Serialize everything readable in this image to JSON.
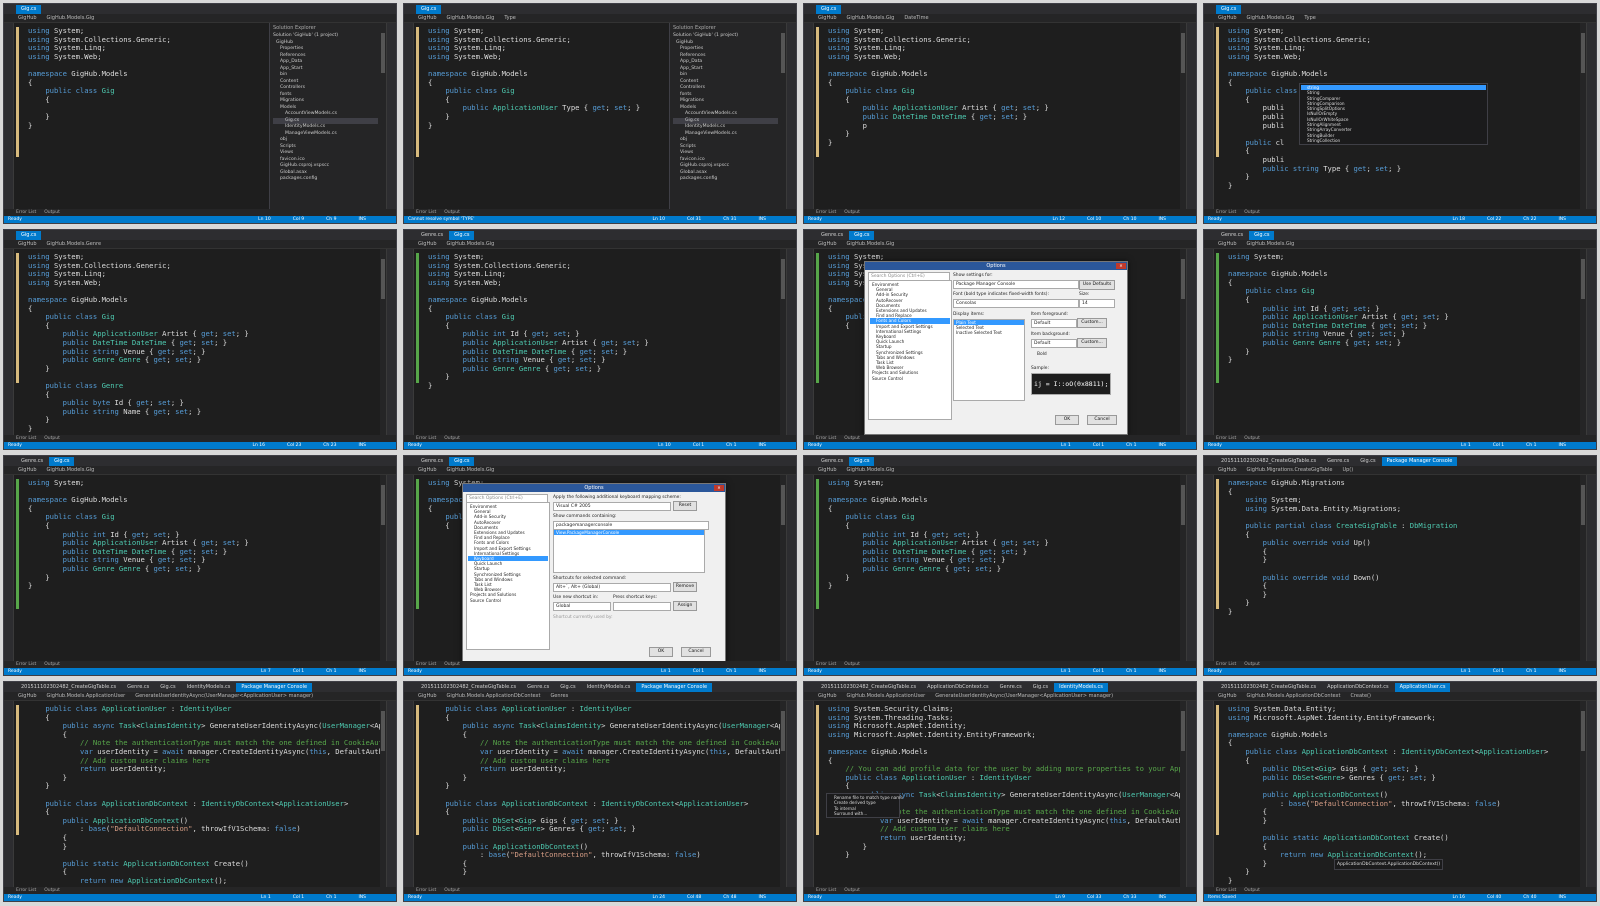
{
  "colors": {
    "accent": "#007acc",
    "editor_bg": "#1e1e1e",
    "keyword": "#569cd6",
    "type": "#4ec9b0",
    "comment": "#57a64a",
    "string": "#d69d85"
  },
  "panels": [
    {
      "tabs": [
        "Gig.cs"
      ],
      "nav": [
        "GigHub",
        "GigHub.Models.Gig"
      ],
      "code": "using System;\nusing System.Collections.Generic;\nusing System.Linq;\nusing System.Web;\n\nnamespace GigHub.Models\n{\n    public class Gig\n    {\n\n    }\n}",
      "status": [
        "Ready",
        "Ln 10",
        "Col 9",
        "Ch 9",
        "INS"
      ],
      "solution_explorer": {
        "title": "Solution Explorer",
        "items": [
          "Solution 'GigHub' (1 project)",
          "GigHub",
          "Properties",
          "References",
          "App_Data",
          "App_Start",
          "bin",
          "Content",
          "Controllers",
          "fonts",
          "Migrations",
          "Models",
          "AccountViewModels.cs",
          "Gig.cs",
          "IdentityModels.cs",
          "ManageViewModels.cs",
          "obj",
          "Scripts",
          "Views",
          "favicon.ico",
          "GigHub.csproj.vspscc",
          "Global.asax",
          "packages.config"
        ]
      }
    },
    {
      "tabs": [
        "Gig.cs"
      ],
      "nav": [
        "GigHub",
        "GigHub.Models.Gig",
        "Type"
      ],
      "code": "using System;\nusing System.Collections.Generic;\nusing System.Linq;\nusing System.Web;\n\nnamespace GigHub.Models\n{\n    public class Gig\n    {\n        public ApplicationUser Type { get; set; }\n    }\n}",
      "status": [
        "Cannot resolve symbol 'TYPE'",
        "Ln 10",
        "Col 31",
        "Ch 31",
        "INS"
      ],
      "solution_explorer": {
        "title": "Solution Explorer",
        "items": [
          "Solution 'GigHub' (1 project)",
          "GigHub",
          "Properties",
          "References",
          "App_Data",
          "App_Start",
          "bin",
          "Content",
          "Controllers",
          "fonts",
          "Migrations",
          "Models",
          "AccountViewModels.cs",
          "Gig.cs",
          "IdentityModels.cs",
          "ManageViewModels.cs",
          "obj",
          "Scripts",
          "Views",
          "favicon.ico",
          "GigHub.csproj.vspscc",
          "Global.asax",
          "packages.config"
        ]
      }
    },
    {
      "tabs": [
        "Gig.cs"
      ],
      "nav": [
        "GigHub",
        "GigHub.Models.Gig",
        "DateTime"
      ],
      "code": "using System;\nusing System.Collections.Generic;\nusing System.Linq;\nusing System.Web;\n\nnamespace GigHub.Models\n{\n    public class Gig\n    {\n        public ApplicationUser Artist { get; set; }\n        public DateTime DateTime { get; set; }\n        p\n    }\n}",
      "status": [
        "Ready",
        "Ln 12",
        "Col 10",
        "Ch 10",
        "INS"
      ]
    },
    {
      "tabs": [
        "Gig.cs"
      ],
      "nav": [
        "GigHub",
        "GigHub.Models.Gig",
        "Type"
      ],
      "code": "using System;\nusing System.Collections.Generic;\nusing System.Linq;\nusing System.Web;\n\nnamespace GigHub.Models\n{\n    public class Gig\n    {\n        publi\n        publi\n        publi\n\n    public cl\n    {\n        publi\n        public string Type { get; set; }\n    }\n}",
      "status": [
        "Ready",
        "Ln 18",
        "Col 22",
        "Ch 22",
        "INS"
      ],
      "completion": [
        "string",
        "String",
        "StringComparer",
        "StringComparison",
        "StringSplitOptions",
        "IsNullOrEmpty",
        "IsNullOrWhiteSpace",
        "StringAlignment",
        "StringArrayConverter",
        "StringBuilder",
        "StringCollection"
      ]
    },
    {
      "tabs": [
        "Gig.cs"
      ],
      "nav": [
        "GigHub",
        "GigHub.Models.Genre"
      ],
      "code": "using System;\nusing System.Collections.Generic;\nusing System.Linq;\nusing System.Web;\n\nnamespace GigHub.Models\n{\n    public class Gig\n    {\n        public ApplicationUser Artist { get; set; }\n        public DateTime DateTime { get; set; }\n        public string Venue { get; set; }\n        public Genre Genre { get; set; }\n    }\n\n    public class Genre\n    {\n        public byte Id { get; set; }\n        public string Name { get; set; }\n    }\n}",
      "status": [
        "Ready",
        "Ln 16",
        "Col 23",
        "Ch 23",
        "INS"
      ]
    },
    {
      "tabs": [
        "Genre.cs",
        "Gig.cs"
      ],
      "nav": [
        "GigHub",
        "GigHub.Models.Gig"
      ],
      "code": "using System;\nusing System.Collections.Generic;\nusing System.Linq;\nusing System.Web;\n\nnamespace GigHub.Models\n{\n    public class Gig\n    {\n        public int Id { get; set; }\n        public ApplicationUser Artist { get; set; }\n        public DateTime DateTime { get; set; }\n        public string Venue { get; set; }\n        public Genre Genre { get; set; }\n    }\n}",
      "status": [
        "Ready",
        "Ln 10",
        "Col 1",
        "Ch 1",
        "INS"
      ]
    },
    {
      "tabs": [
        "Genre.cs",
        "Gig.cs"
      ],
      "nav": [
        "GigHub",
        "GigHub.Models.Gig"
      ],
      "code": "using System;\nusing System.Collections.Generic;\nusing System.Linq;\nusing System.Web;\n\nnamespace GigHub.Models\n{\n    public class Gig\n    {",
      "status": [
        "Ready",
        "Ln 1",
        "Col 1",
        "Ch 1",
        "INS"
      ],
      "options": {
        "title": "Options",
        "search": "Search Options (Ctrl+E)",
        "show_settings": "Show settings for:",
        "show_settings_value": "Package Manager Console",
        "use_defaults": "Use Defaults",
        "font_label": "Font (bold type indicates fixed-width fonts):",
        "font_value": "Consolas",
        "size_label": "Size:",
        "size_value": "14",
        "display_items": "Display items:",
        "display_list": [
          "Plain Text",
          "Selected Text",
          "Inactive Selected Text"
        ],
        "fg_label": "Item foreground:",
        "fg_value": "Default",
        "bg_label": "Item background:",
        "bg_value": "Default",
        "custom": "Custom...",
        "bold": "Bold",
        "sample_label": "Sample:",
        "sample": "ij = I::oO(0x8811);",
        "ok": "OK",
        "cancel": "Cancel",
        "tree": [
          "Environment",
          "General",
          "Add-in Security",
          "AutoRecover",
          "Documents",
          "Extensions and Updates",
          "Find and Replace",
          "Fonts and Colors",
          "Import and Export Settings",
          "International Settings",
          "Keyboard",
          "Quick Launch",
          "Startup",
          "Synchronized Settings",
          "Tabs and Windows",
          "Task List",
          "Web Browser",
          "Projects and Solutions",
          "Source Control"
        ]
      }
    },
    {
      "tabs": [
        "Genre.cs",
        "Gig.cs"
      ],
      "nav": [
        "GigHub",
        "GigHub.Models.Gig"
      ],
      "code": "using System;\n\nnamespace GigHub.Models\n{\n    public class Gig\n    {\n        public int Id { get; set; }\n        public ApplicationUser Artist { get; set; }\n        public DateTime DateTime { get; set; }\n        public string Venue { get; set; }\n        public Genre Genre { get; set; }\n    }\n}",
      "status": [
        "Ready",
        "Ln 1",
        "Col 1",
        "Ch 1",
        "INS"
      ]
    },
    {
      "tabs": [
        "Genre.cs",
        "Gig.cs"
      ],
      "nav": [
        "GigHub",
        "GigHub.Models.Gig"
      ],
      "code": "using System;\n\nnamespace GigHub.Models\n{\n    public class Gig\n    {\n        public int Id { get; set; }\n        public ApplicationUser Artist { get; set; }\n        public DateTime DateTime { get; set; }\n        public string Venue { get; set; }\n        public Genre Genre { get; set; }\n    }\n}",
      "status": [
        "Ready",
        "Ln 7",
        "Col 1",
        "Ch 1",
        "INS"
      ]
    },
    {
      "tabs": [
        "Genre.cs",
        "Gig.cs"
      ],
      "nav": [
        "GigHub",
        "GigHub.Models.Gig"
      ],
      "code": "using System;\n\nnamespace GigHub.Models\n{\n    public class Gig\n    {",
      "status": [
        "Ready",
        "Ln 1",
        "Col 1",
        "Ch 1",
        "INS"
      ],
      "options": {
        "title": "Options",
        "search": "Search Options (Ctrl+E)",
        "mapping_label": "Apply the following additional keyboard mapping scheme:",
        "mapping_value": "Visual C# 2005",
        "reset": "Reset",
        "commands_label": "Show commands containing:",
        "commands_value": "packagemanagerconsole",
        "command_selected": "View.PackageManagerConsole",
        "shortcuts_label": "Shortcuts for selected command:",
        "shortcuts_value": "Alt+`, Alt+ (Global)",
        "remove": "Remove",
        "use_new_label": "Use new shortcut in:",
        "use_new_value": "Global",
        "press_label": "Press shortcut keys:",
        "assign": "Assign",
        "shortcut_used": "Shortcut currently used by:",
        "ok": "OK",
        "cancel": "Cancel",
        "tree": [
          "Environment",
          "General",
          "Add-in Security",
          "AutoRecover",
          "Documents",
          "Extensions and Updates",
          "Find and Replace",
          "Fonts and Colors",
          "Import and Export Settings",
          "International Settings",
          "Keyboard",
          "Quick Launch",
          "Startup",
          "Synchronized Settings",
          "Tabs and Windows",
          "Task List",
          "Web Browser",
          "Projects and Solutions",
          "Source Control"
        ]
      }
    },
    {
      "tabs": [
        "Genre.cs",
        "Gig.cs"
      ],
      "nav": [
        "GigHub",
        "GigHub.Models.Gig"
      ],
      "code": "using System;\n\nnamespace GigHub.Models\n{\n    public class Gig\n    {\n        public int Id { get; set; }\n        public ApplicationUser Artist { get; set; }\n        public DateTime DateTime { get; set; }\n        public string Venue { get; set; }\n        public Genre Genre { get; set; }\n    }\n}",
      "status": [
        "Ready",
        "Ln 1",
        "Col 1",
        "Ch 1",
        "INS"
      ]
    },
    {
      "tabs": [
        "201511102302482_CreateGigTable.cs",
        "Genre.cs",
        "Gig.cs",
        "Package Manager Console"
      ],
      "nav": [
        "GigHub",
        "GigHub.Migrations.CreateGigTable",
        "Up()"
      ],
      "code": "namespace GigHub.Migrations\n{\n    using System;\n    using System.Data.Entity.Migrations;\n\n    public partial class CreateGigTable : DbMigration\n    {\n        public override void Up()\n        {\n        }\n\n        public override void Down()\n        {\n        }\n    }\n}",
      "status": [
        "Ready",
        "Ln 1",
        "Col 1",
        "Ch 1",
        "INS"
      ]
    },
    {
      "tabs": [
        "201511102302482_CreateGigTable.cs",
        "Genre.cs",
        "Gig.cs",
        "IdentityModels.cs",
        "Package Manager Console"
      ],
      "nav": [
        "GigHub",
        "GigHub.Models.ApplicationUser",
        "GenerateUserIdentityAsync(UserManager<ApplicationUser> manager)"
      ],
      "code": "    public class ApplicationUser : IdentityUser\n    {\n        public async Task<ClaimsIdentity> GenerateUserIdentityAsync(UserManager<Appl\n        {\n            // Note the authenticationType must match the one defined in CookieAuthe\n            var userIdentity = await manager.CreateIdentityAsync(this, DefaultAuthen\n            // Add custom user claims here\n            return userIdentity;\n        }\n    }\n\n    public class ApplicationDbContext : IdentityDbContext<ApplicationUser>\n    {\n        public ApplicationDbContext()\n            : base(\"DefaultConnection\", throwIfV1Schema: false)\n        {\n        }\n\n        public static ApplicationDbContext Create()\n        {\n            return new ApplicationDbContext();",
      "status": [
        "Ready",
        "Ln 1",
        "Col 1",
        "Ch 1",
        "INS"
      ]
    },
    {
      "tabs": [
        "201511102302482_CreateGigTable.cs",
        "Genre.cs",
        "Gig.cs",
        "IdentityModels.cs",
        "Package Manager Console"
      ],
      "nav": [
        "GigHub",
        "GigHub.Models.ApplicationDbContext",
        "Genres"
      ],
      "code": "    public class ApplicationUser : IdentityUser\n    {\n        public async Task<ClaimsIdentity> GenerateUserIdentityAsync(UserManager<Appl\n        {\n            // Note the authenticationType must match the one defined in CookieAuthe\n            var userIdentity = await manager.CreateIdentityAsync(this, DefaultAuthen\n            // Add custom user claims here\n            return userIdentity;\n        }\n    }\n\n    public class ApplicationDbContext : IdentityDbContext<ApplicationUser>\n    {\n        public DbSet<Gig> Gigs { get; set; }\n        public DbSet<Genre> Genres { get; set; }\n\n        public ApplicationDbContext()\n            : base(\"DefaultConnection\", throwIfV1Schema: false)\n        {\n        }",
      "status": [
        "Ready",
        "Ln 24",
        "Col 48",
        "Ch 48",
        "INS"
      ]
    },
    {
      "tabs": [
        "201511102302482_CreateGigTable.cs",
        "ApplicationDbContext.cs",
        "Genre.cs",
        "Gig.cs",
        "IdentityModels.cs"
      ],
      "nav": [
        "GigHub",
        "GigHub.Models.ApplicationUser",
        "GenerateUserIdentityAsync(UserManager<ApplicationUser> manager)"
      ],
      "code": "using System.Security.Claims;\nusing System.Threading.Tasks;\nusing Microsoft.AspNet.Identity;\nusing Microsoft.AspNet.Identity.EntityFramework;\n\nnamespace GigHub.Models\n{\n    // You can add profile data for the user by adding more properties to your Appli\n    public class ApplicationUser : IdentityUser\n    {\n        public async Task<ClaimsIdentity> GenerateUserIdentityAsync(UserManager<Appl\n        {\n            // Note the authenticationType must match the one defined in CookieAuthe\n            var userIdentity = await manager.CreateIdentityAsync(this, DefaultAuthen\n            // Add custom user claims here\n            return userIdentity;\n        }\n    }",
      "status": [
        "Ready",
        "Ln 9",
        "Col 33",
        "Ch 33",
        "INS"
      ],
      "context_menu": [
        "Rename file to match type name",
        "Create derived type",
        "To internal",
        "Surround with..."
      ]
    },
    {
      "tabs": [
        "201511102302482_CreateGigTable.cs",
        "ApplicationDbContext.cs",
        "ApplicationUser.cs"
      ],
      "nav": [
        "GigHub",
        "GigHub.Models.ApplicationDbContext",
        "Create()"
      ],
      "code": "using System.Data.Entity;\nusing Microsoft.AspNet.Identity.EntityFramework;\n\nnamespace GigHub.Models\n{\n    public class ApplicationDbContext : IdentityDbContext<ApplicationUser>\n    {\n        public DbSet<Gig> Gigs { get; set; }\n        public DbSet<Genre> Genres { get; set; }\n\n        public ApplicationDbContext()\n            : base(\"DefaultConnection\", throwIfV1Schema: false)\n        {\n        }\n\n        public static ApplicationDbContext Create()\n        {\n            return new ApplicationDbContext();\n        }\n    }\n}",
      "status": [
        "Items Saved",
        "Ln 16",
        "Col 40",
        "Ch 40",
        "INS"
      ],
      "tooltip": "ApplicationDbContext.ApplicationDbContext()"
    }
  ]
}
